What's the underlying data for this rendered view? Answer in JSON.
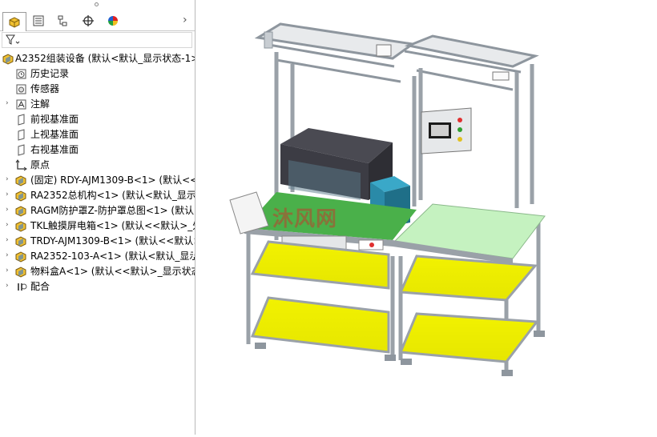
{
  "tabs": [
    {
      "name": "feature-manager-tab",
      "icon": "feature-tree-icon"
    },
    {
      "name": "property-manager-tab",
      "icon": "property-list-icon"
    },
    {
      "name": "configuration-manager-tab",
      "icon": "configuration-icon"
    },
    {
      "name": "dimxpert-manager-tab",
      "icon": "crosshair-icon"
    },
    {
      "name": "display-manager-tab",
      "icon": "color-pie-icon"
    }
  ],
  "tab_more": "›",
  "tree": {
    "root": "A2352组装设备 (默认<默认_显示状态-1>",
    "items": [
      {
        "label": "历史记录",
        "icon": "history-icon",
        "arrow": ""
      },
      {
        "label": "传感器",
        "icon": "sensor-icon",
        "arrow": ""
      },
      {
        "label": "注解",
        "icon": "annotation-icon",
        "arrow": "›"
      },
      {
        "label": "前视基准面",
        "icon": "plane-icon",
        "arrow": ""
      },
      {
        "label": "上视基准面",
        "icon": "plane-icon",
        "arrow": ""
      },
      {
        "label": "右视基准面",
        "icon": "plane-icon",
        "arrow": ""
      },
      {
        "label": "原点",
        "icon": "origin-icon",
        "arrow": ""
      },
      {
        "label": "(固定) RDY-AJM1309-B<1> (默认<<默",
        "icon": "assembly-icon",
        "arrow": "›"
      },
      {
        "label": "RA2352总机构<1> (默认<默认_显示状",
        "icon": "assembly-icon",
        "arrow": "›"
      },
      {
        "label": "RAGM防护罩Z-防护罩总图<1> (默认<",
        "icon": "assembly-icon",
        "arrow": "›"
      },
      {
        "label": "TKL触摸屏电箱<1> (默认<<默认>_外",
        "icon": "assembly-icon",
        "arrow": "›"
      },
      {
        "label": "TRDY-AJM1309-B<1> (默认<<默认>",
        "icon": "assembly-icon",
        "arrow": "›"
      },
      {
        "label": "RA2352-103-A<1> (默认<默认_显示",
        "icon": "assembly-icon",
        "arrow": "›"
      },
      {
        "label": "物料盒A<1> (默认<<默认>_显示状态",
        "icon": "assembly-icon",
        "arrow": "›"
      },
      {
        "label": "配合",
        "icon": "mates-icon",
        "arrow": "›"
      }
    ]
  },
  "watermark": "沐风网",
  "colors": {
    "frame": "#8e969e",
    "shelf": "#f0f000",
    "table_top": "#c5f2c0",
    "cover": "#3c3c44",
    "panel_bg": "#ffffff"
  }
}
